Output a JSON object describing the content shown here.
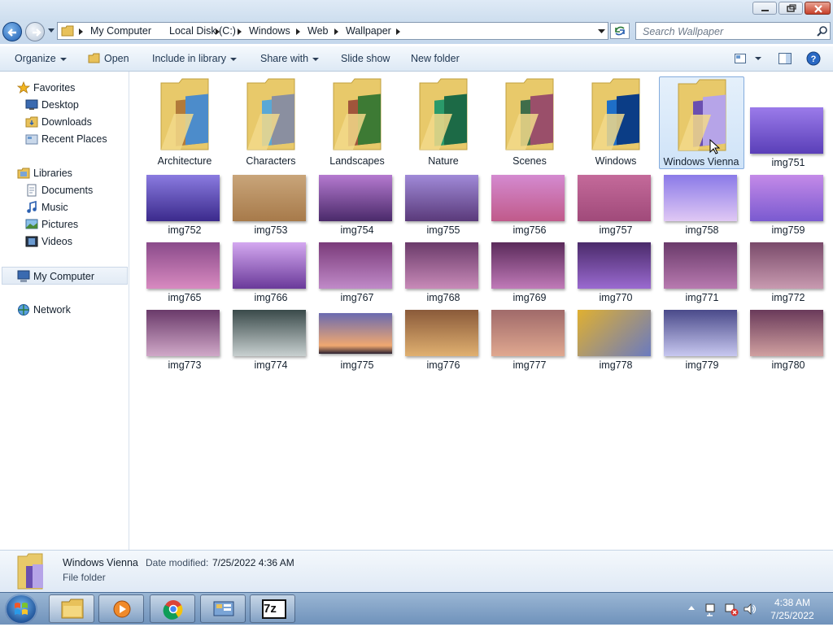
{
  "window": {
    "controls": [
      "minimize-button",
      "restore-button",
      "close-button"
    ]
  },
  "address": {
    "crumbs": [
      "My Computer",
      "Local Disk (C:)",
      "Windows",
      "Web",
      "Wallpaper"
    ]
  },
  "search": {
    "placeholder": "Search Wallpaper"
  },
  "toolbar": {
    "organize": "Organize",
    "open": "Open",
    "include_in_library": "Include in library",
    "share_with": "Share with",
    "slide_show": "Slide show",
    "new_folder": "New folder"
  },
  "nav": {
    "favorites": "Favorites",
    "desktop": "Desktop",
    "downloads": "Downloads",
    "recent_places": "Recent Places",
    "libraries": "Libraries",
    "documents": "Documents",
    "music": "Music",
    "pictures": "Pictures",
    "videos": "Videos",
    "my_computer": "My Computer",
    "network": "Network"
  },
  "folders": [
    {
      "name": "Architecture",
      "c1": "#b27a3a",
      "c2": "#4c8ccb"
    },
    {
      "name": "Characters",
      "c1": "#59a8d6",
      "c2": "#8a8fa0"
    },
    {
      "name": "Landscapes",
      "c1": "#a0553b",
      "c2": "#3d7a34"
    },
    {
      "name": "Nature",
      "c1": "#2a9a6a",
      "c2": "#1c6a46"
    },
    {
      "name": "Scenes",
      "c1": "#3f6d4a",
      "c2": "#9a4f6a"
    },
    {
      "name": "Windows",
      "c1": "#1e6fc8",
      "c2": "#0b3d86"
    },
    {
      "name": "Windows Vienna",
      "c1": "#6a4fb0",
      "c2": "#b6a4e8"
    }
  ],
  "images": [
    {
      "name": "img751",
      "c1": "#9b7bea",
      "c2": "#5a3fb8"
    },
    {
      "name": "img752",
      "c1": "#8a7be0",
      "c2": "#3b2a8c"
    },
    {
      "name": "img753",
      "c1": "#c9a57a",
      "c2": "#a77a4a"
    },
    {
      "name": "img754",
      "c1": "#b57ad0",
      "c2": "#4a2a6a"
    },
    {
      "name": "img755",
      "c1": "#a08ad8",
      "c2": "#5a3a7a"
    },
    {
      "name": "img756",
      "c1": "#d48ad0",
      "c2": "#c05a8a"
    },
    {
      "name": "img757",
      "c1": "#c46a9a",
      "c2": "#a04a7a"
    },
    {
      "name": "img758",
      "c1": "#8a7ae8",
      "c2": "#e0c8f4"
    },
    {
      "name": "img759",
      "c1": "#c48ae8",
      "c2": "#7a5ad0"
    },
    {
      "name": "img765",
      "c1": "#8a4a8a",
      "c2": "#d88ac0"
    },
    {
      "name": "img766",
      "c1": "#d4a8f0",
      "c2": "#6a3a9a"
    },
    {
      "name": "img767",
      "c1": "#7a3a7a",
      "c2": "#c08ac8"
    },
    {
      "name": "img768",
      "c1": "#6a3a6a",
      "c2": "#c88ab8"
    },
    {
      "name": "img769",
      "c1": "#5a2a5a",
      "c2": "#c07ab8"
    },
    {
      "name": "img770",
      "c1": "#4a2a6a",
      "c2": "#9a6ad0"
    },
    {
      "name": "img771",
      "c1": "#6a3a6a",
      "c2": "#b87ab0"
    },
    {
      "name": "img772",
      "c1": "#7a4a6a",
      "c2": "#c89ab0"
    },
    {
      "name": "img773",
      "c1": "#6a3a6a",
      "c2": "#d0a8c8"
    },
    {
      "name": "img774",
      "c1": "#3a4a4a",
      "c2": "#c8d0d0"
    },
    {
      "name": "img775",
      "c1": "#6a6ab0",
      "c2": "#f0a870"
    },
    {
      "name": "img776",
      "c1": "#8a5a3a",
      "c2": "#e0b070"
    },
    {
      "name": "img777",
      "c1": "#a06a6a",
      "c2": "#e0a890"
    },
    {
      "name": "img778",
      "c1": "#e0b030",
      "c2": "#6a7ac0"
    },
    {
      "name": "img779",
      "c1": "#4a4a8a",
      "c2": "#c8c8f0"
    },
    {
      "name": "img780",
      "c1": "#6a3a5a",
      "c2": "#d0a0a0"
    }
  ],
  "details": {
    "name": "Windows Vienna",
    "date_modified_label": "Date modified:",
    "date_modified": "7/25/2022 4:36 AM",
    "type": "File folder"
  },
  "taskbar": {
    "apps": [
      "explorer-taskbar-icon",
      "media-player-taskbar-icon",
      "chrome-taskbar-icon",
      "control-panel-taskbar-icon",
      "7zip-taskbar-icon"
    ],
    "sevenzip_label": "7z"
  },
  "clock": {
    "time": "4:38 AM",
    "date": "7/25/2022"
  }
}
